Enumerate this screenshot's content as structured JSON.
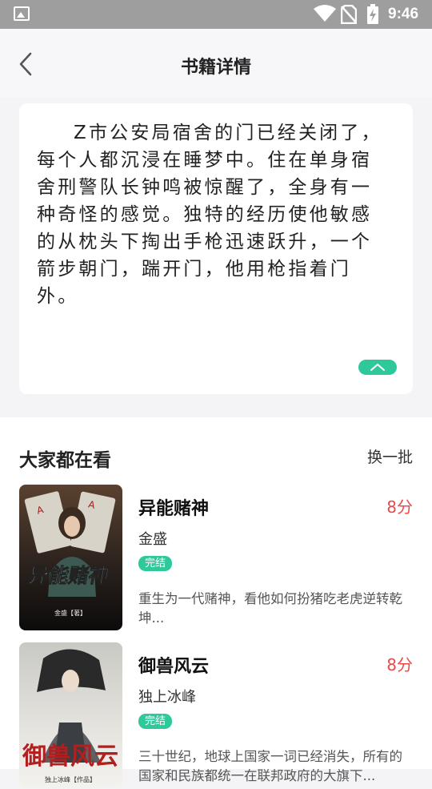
{
  "status_bar": {
    "time": "9:46"
  },
  "nav": {
    "title": "书籍详情"
  },
  "description": "Z市公安局宿舍的门已经关闭了，每个人都沉浸在睡梦中。住在单身宿舍刑警队长钟鸣被惊醒了，全身有一种奇怪的感觉。独特的经历使他敏感的从枕头下掏出手枪迅速跃升，一个箭步朝门，踹开门，他用枪指着门外。",
  "recommend": {
    "title": "大家都在看",
    "refresh_label": "换一批",
    "books": [
      {
        "name": "异能赌神",
        "score": "8分",
        "author": "金盛",
        "status": "完结",
        "intro": "重生为一代赌神，看他如何扮猪吃老虎逆转乾坤...",
        "cover_title": "异能赌神",
        "cover_author": "金盛【著】"
      },
      {
        "name": "御兽风云",
        "score": "8分",
        "author": "独上冰峰",
        "status": "完结",
        "intro": "三十世纪，地球上国家一词已经消失，所有的国家和民族都统一在联邦政府的大旗下...",
        "cover_title": "御兽风云",
        "cover_author": "独上冰峰【作品】"
      }
    ]
  },
  "colors": {
    "accent": "#2dc99a",
    "score": "#e84a4a"
  }
}
